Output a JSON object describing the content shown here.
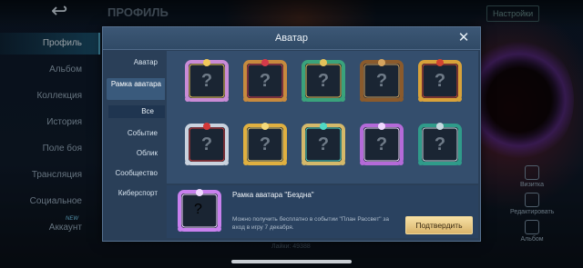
{
  "background": {
    "title": "ПРОФИЛЬ",
    "settings_label": "Настройки",
    "sidebar": [
      {
        "label": "Профиль",
        "active": true
      },
      {
        "label": "Альбом"
      },
      {
        "label": "Коллекция"
      },
      {
        "label": "История"
      },
      {
        "label": "Поле боя"
      },
      {
        "label": "Трансляция"
      },
      {
        "label": "Социальное"
      },
      {
        "label": "Аккаунт",
        "badge": "NEW"
      }
    ],
    "right_icons": [
      "Визитка",
      "Редактировать",
      "Альбом"
    ],
    "likes_text": "Лайки: 49388"
  },
  "modal": {
    "title": "Аватар",
    "nav": [
      {
        "label": "Аватар"
      },
      {
        "label": "Рамка аватара",
        "active": true
      },
      {
        "label": "Все",
        "sub": true
      },
      {
        "label": "Событие"
      },
      {
        "label": "Облик"
      },
      {
        "label": "Сообщество"
      },
      {
        "label": "Киберспорт"
      }
    ],
    "frames": [
      {
        "name": "frame-1",
        "color": "#c98bd6",
        "accent": "#f0c85a"
      },
      {
        "name": "frame-2",
        "color": "#c78a3e",
        "accent": "#d43a4a"
      },
      {
        "name": "frame-3",
        "color": "#3aa37c",
        "accent": "#e3c15a"
      },
      {
        "name": "frame-4",
        "color": "#8a5a2c",
        "accent": "#d6a45e"
      },
      {
        "name": "frame-5",
        "color": "#d8a23a",
        "accent": "#d24430"
      },
      {
        "name": "frame-6",
        "color": "#c9d2de",
        "accent": "#d23838"
      },
      {
        "name": "frame-7",
        "color": "#e0b040",
        "accent": "#f5d97a"
      },
      {
        "name": "frame-8",
        "color": "#d4b96a",
        "accent": "#4fd9c5"
      },
      {
        "name": "frame-9",
        "color": "#b46ad8",
        "accent": "#f0d8ff"
      },
      {
        "name": "frame-10",
        "color": "#2f9b8a",
        "accent": "#c5d9e0"
      }
    ],
    "question_mark": "?",
    "selected": {
      "name": "Рамка аватара \"Бездна\"",
      "description": "Можно получить бесплатно в событии \"План Рассвет\" за вход в игру 7 декабря.",
      "confirm_label": "Подтвердить",
      "color": "#c880ee"
    }
  }
}
